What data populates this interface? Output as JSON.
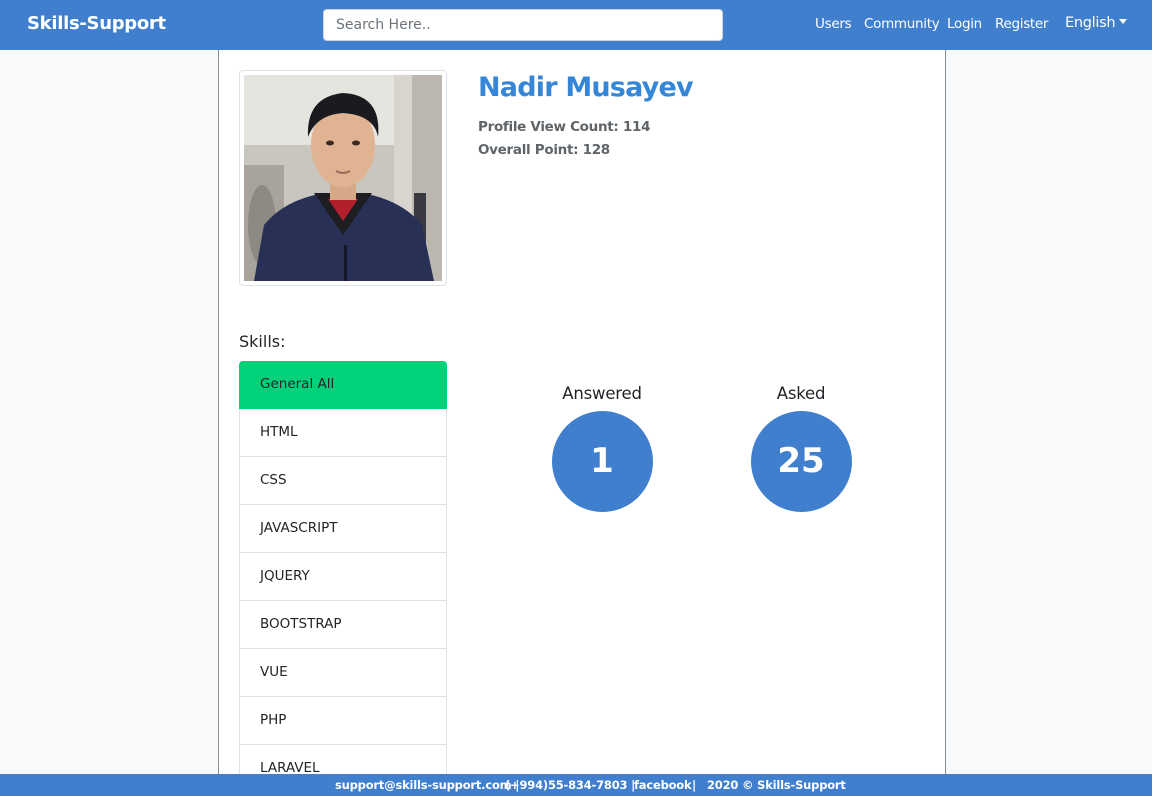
{
  "nav": {
    "brand": "Skills-Support",
    "search_placeholder": "Search Here..",
    "links": [
      "Users",
      "Community",
      "Login",
      "Register"
    ],
    "language": "English"
  },
  "profile": {
    "name": "Nadir Musayev",
    "view_count": "Profile View Count: 114",
    "overall_point": "Overall Point: 128"
  },
  "skills": {
    "label": "Skills:",
    "items": [
      "General All",
      "HTML",
      "CSS",
      "JAVASCRIPT",
      "JQUERY",
      "BOOTSTRAP",
      "VUE",
      "PHP",
      "LARAVEL"
    ],
    "active": "General All"
  },
  "stats": {
    "answered_label": "Answered",
    "answered_value": "1",
    "asked_label": "Asked",
    "asked_value": "25"
  },
  "footer": {
    "email": "support@skills-support.com |",
    "phone": "(+994)55-834-7803 |",
    "facebook": "facebook",
    "separator": "|",
    "copyright": "2020 © Skills-Support"
  },
  "colors": {
    "primary": "#3f7fce",
    "accent_green": "#00d27a",
    "name_blue": "#3586d6"
  }
}
